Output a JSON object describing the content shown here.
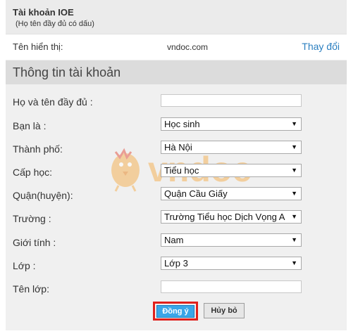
{
  "account": {
    "title": "Tài khoản IOE",
    "subtitle": "(Họ tên đầy đủ có dấu)",
    "display_name_label": "Tên hiển thị:",
    "display_name_value": "vndoc.com",
    "change_link": "Thay đổi"
  },
  "section": {
    "title": "Thông tin tài khoản"
  },
  "form": {
    "full_name": {
      "label": "Họ và tên đầy đủ :",
      "value": ""
    },
    "role": {
      "label": "Bạn là :",
      "value": "Học sinh"
    },
    "city": {
      "label": "Thành phố:",
      "value": "Hà Nội"
    },
    "level": {
      "label": "Cấp học:",
      "value": "Tiểu học"
    },
    "district": {
      "label": "Quận(huyện):",
      "value": "Quận Cầu Giấy"
    },
    "school": {
      "label": "Trường :",
      "value": "Trường Tiểu học Dịch Vọng A"
    },
    "gender": {
      "label": "Giới tính :",
      "value": "Nam"
    },
    "grade": {
      "label": "Lớp :",
      "value": "Lớp 3"
    },
    "class_name": {
      "label": "Tên lớp:",
      "value": ""
    },
    "dropdown_arrow": "▼"
  },
  "buttons": {
    "ok": "Đồng ý",
    "cancel": "Hủy bỏ"
  },
  "watermark": {
    "text": "vndoc"
  },
  "colors": {
    "panel_bg": "#f0f0f0",
    "section_bg": "#dcdcdc",
    "link": "#2b7fc0",
    "ok_button": "#3aa6e8",
    "highlight_frame": "#e0201b",
    "watermark": "#f5b45a"
  }
}
